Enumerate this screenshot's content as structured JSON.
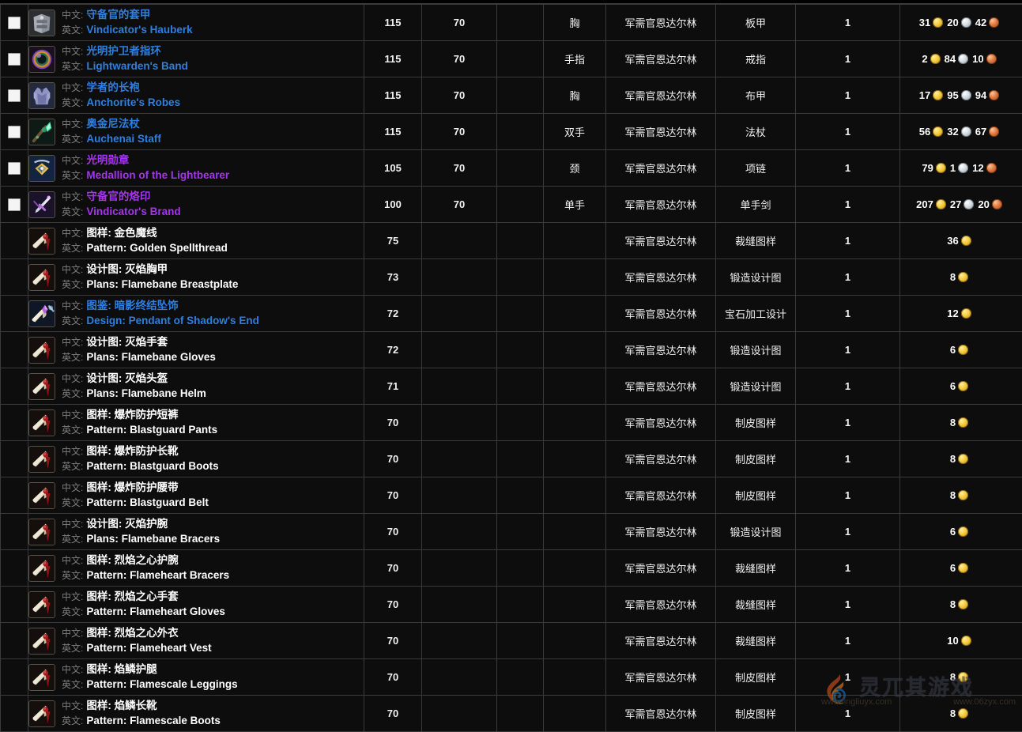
{
  "meta": {
    "label_cn": "中文:",
    "label_en": "英文:"
  },
  "watermark": {
    "text_cn": "灵兀其游戏",
    "url_left": "www.lingliuyx.com",
    "url_right": "www.06zyx.com"
  },
  "rows": [
    {
      "checkbox": true,
      "quality": "rare",
      "icon": "chest-mail-icon",
      "name_cn": "守备官的套甲",
      "name_en": "Vindicator's Hauberk",
      "ilvl": "115",
      "req": "70",
      "blank": "",
      "slot": "胸",
      "source": "军需官恩达尔林",
      "type": "板甲",
      "qty": "1",
      "price": [
        {
          "amount": "31",
          "coin": "g"
        },
        {
          "amount": "20",
          "coin": "s"
        },
        {
          "amount": "42",
          "coin": "c"
        }
      ]
    },
    {
      "checkbox": true,
      "quality": "rare",
      "icon": "ring-icon",
      "name_cn": "光明护卫者指环",
      "name_en": "Lightwarden's Band",
      "ilvl": "115",
      "req": "70",
      "blank": "",
      "slot": "手指",
      "source": "军需官恩达尔林",
      "type": "戒指",
      "qty": "1",
      "price": [
        {
          "amount": "2",
          "coin": "g"
        },
        {
          "amount": "84",
          "coin": "s"
        },
        {
          "amount": "10",
          "coin": "c"
        }
      ]
    },
    {
      "checkbox": true,
      "quality": "rare",
      "icon": "robe-icon",
      "name_cn": "学者的长袍",
      "name_en": "Anchorite's Robes",
      "ilvl": "115",
      "req": "70",
      "blank": "",
      "slot": "胸",
      "source": "军需官恩达尔林",
      "type": "布甲",
      "qty": "1",
      "price": [
        {
          "amount": "17",
          "coin": "g"
        },
        {
          "amount": "95",
          "coin": "s"
        },
        {
          "amount": "94",
          "coin": "c"
        }
      ]
    },
    {
      "checkbox": true,
      "quality": "rare",
      "icon": "staff-icon",
      "name_cn": "奥金尼法杖",
      "name_en": "Auchenai Staff",
      "ilvl": "115",
      "req": "70",
      "blank": "",
      "slot": "双手",
      "source": "军需官恩达尔林",
      "type": "法杖",
      "qty": "1",
      "price": [
        {
          "amount": "56",
          "coin": "g"
        },
        {
          "amount": "32",
          "coin": "s"
        },
        {
          "amount": "67",
          "coin": "c"
        }
      ]
    },
    {
      "checkbox": true,
      "quality": "epic",
      "icon": "medallion-icon",
      "name_cn": "光明勋章",
      "name_en": "Medallion of the Lightbearer",
      "ilvl": "105",
      "req": "70",
      "blank": "",
      "slot": "颈",
      "source": "军需官恩达尔林",
      "type": "项链",
      "qty": "1",
      "price": [
        {
          "amount": "79",
          "coin": "g"
        },
        {
          "amount": "1",
          "coin": "s"
        },
        {
          "amount": "12",
          "coin": "c"
        }
      ]
    },
    {
      "checkbox": true,
      "quality": "epic",
      "icon": "sword-icon",
      "name_cn": "守备官的烙印",
      "name_en": "Vindicator's Brand",
      "ilvl": "100",
      "req": "70",
      "blank": "",
      "slot": "单手",
      "source": "军需官恩达尔林",
      "type": "单手剑",
      "qty": "1",
      "price": [
        {
          "amount": "207",
          "coin": "g"
        },
        {
          "amount": "27",
          "coin": "s"
        },
        {
          "amount": "20",
          "coin": "c"
        }
      ]
    },
    {
      "checkbox": false,
      "quality": "common",
      "icon": "scroll-icon",
      "name_cn": "图样: 金色魔线",
      "name_en": "Pattern: Golden Spellthread",
      "ilvl": "75",
      "req": "",
      "blank": "",
      "slot": "",
      "source": "军需官恩达尔林",
      "type": "裁缝图样",
      "qty": "1",
      "price": [
        {
          "amount": "36",
          "coin": "g"
        }
      ]
    },
    {
      "checkbox": false,
      "quality": "common",
      "icon": "scroll-icon",
      "name_cn": "设计图: 灭焰胸甲",
      "name_en": "Plans: Flamebane Breastplate",
      "ilvl": "73",
      "req": "",
      "blank": "",
      "slot": "",
      "source": "军需官恩达尔林",
      "type": "锻造设计图",
      "qty": "1",
      "price": [
        {
          "amount": "8",
          "coin": "g"
        }
      ]
    },
    {
      "checkbox": false,
      "quality": "rare",
      "icon": "design-icon",
      "name_cn": "图鉴: 暗影终结坠饰",
      "name_en": "Design: Pendant of Shadow's End",
      "ilvl": "72",
      "req": "",
      "blank": "",
      "slot": "",
      "source": "军需官恩达尔林",
      "type": "宝石加工设计",
      "qty": "1",
      "price": [
        {
          "amount": "12",
          "coin": "g"
        }
      ]
    },
    {
      "checkbox": false,
      "quality": "common",
      "icon": "scroll-icon",
      "name_cn": "设计图: 灭焰手套",
      "name_en": "Plans: Flamebane Gloves",
      "ilvl": "72",
      "req": "",
      "blank": "",
      "slot": "",
      "source": "军需官恩达尔林",
      "type": "锻造设计图",
      "qty": "1",
      "price": [
        {
          "amount": "6",
          "coin": "g"
        }
      ]
    },
    {
      "checkbox": false,
      "quality": "common",
      "icon": "scroll-icon",
      "name_cn": "设计图: 灭焰头盔",
      "name_en": "Plans: Flamebane Helm",
      "ilvl": "71",
      "req": "",
      "blank": "",
      "slot": "",
      "source": "军需官恩达尔林",
      "type": "锻造设计图",
      "qty": "1",
      "price": [
        {
          "amount": "6",
          "coin": "g"
        }
      ]
    },
    {
      "checkbox": false,
      "quality": "common",
      "icon": "scroll-icon",
      "name_cn": "图样: 爆炸防护短裤",
      "name_en": "Pattern: Blastguard Pants",
      "ilvl": "70",
      "req": "",
      "blank": "",
      "slot": "",
      "source": "军需官恩达尔林",
      "type": "制皮图样",
      "qty": "1",
      "price": [
        {
          "amount": "8",
          "coin": "g"
        }
      ]
    },
    {
      "checkbox": false,
      "quality": "common",
      "icon": "scroll-icon",
      "name_cn": "图样: 爆炸防护长靴",
      "name_en": "Pattern: Blastguard Boots",
      "ilvl": "70",
      "req": "",
      "blank": "",
      "slot": "",
      "source": "军需官恩达尔林",
      "type": "制皮图样",
      "qty": "1",
      "price": [
        {
          "amount": "8",
          "coin": "g"
        }
      ]
    },
    {
      "checkbox": false,
      "quality": "common",
      "icon": "scroll-icon",
      "name_cn": "图样: 爆炸防护腰带",
      "name_en": "Pattern: Blastguard Belt",
      "ilvl": "70",
      "req": "",
      "blank": "",
      "slot": "",
      "source": "军需官恩达尔林",
      "type": "制皮图样",
      "qty": "1",
      "price": [
        {
          "amount": "8",
          "coin": "g"
        }
      ]
    },
    {
      "checkbox": false,
      "quality": "common",
      "icon": "scroll-icon",
      "name_cn": "设计图: 灭焰护腕",
      "name_en": "Plans: Flamebane Bracers",
      "ilvl": "70",
      "req": "",
      "blank": "",
      "slot": "",
      "source": "军需官恩达尔林",
      "type": "锻造设计图",
      "qty": "1",
      "price": [
        {
          "amount": "6",
          "coin": "g"
        }
      ]
    },
    {
      "checkbox": false,
      "quality": "common",
      "icon": "scroll-icon",
      "name_cn": "图样: 烈焰之心护腕",
      "name_en": "Pattern: Flameheart Bracers",
      "ilvl": "70",
      "req": "",
      "blank": "",
      "slot": "",
      "source": "军需官恩达尔林",
      "type": "裁缝图样",
      "qty": "1",
      "price": [
        {
          "amount": "6",
          "coin": "g"
        }
      ]
    },
    {
      "checkbox": false,
      "quality": "common",
      "icon": "scroll-icon",
      "name_cn": "图样: 烈焰之心手套",
      "name_en": "Pattern: Flameheart Gloves",
      "ilvl": "70",
      "req": "",
      "blank": "",
      "slot": "",
      "source": "军需官恩达尔林",
      "type": "裁缝图样",
      "qty": "1",
      "price": [
        {
          "amount": "8",
          "coin": "g"
        }
      ]
    },
    {
      "checkbox": false,
      "quality": "common",
      "icon": "scroll-icon",
      "name_cn": "图样: 烈焰之心外衣",
      "name_en": "Pattern: Flameheart Vest",
      "ilvl": "70",
      "req": "",
      "blank": "",
      "slot": "",
      "source": "军需官恩达尔林",
      "type": "裁缝图样",
      "qty": "1",
      "price": [
        {
          "amount": "10",
          "coin": "g"
        }
      ]
    },
    {
      "checkbox": false,
      "quality": "common",
      "icon": "scroll-icon",
      "name_cn": "图样: 焰鳞护腿",
      "name_en": "Pattern: Flamescale Leggings",
      "ilvl": "70",
      "req": "",
      "blank": "",
      "slot": "",
      "source": "军需官恩达尔林",
      "type": "制皮图样",
      "qty": "1",
      "price": [
        {
          "amount": "8",
          "coin": "g"
        }
      ]
    },
    {
      "checkbox": false,
      "quality": "common",
      "icon": "scroll-icon",
      "name_cn": "图样: 焰鳞长靴",
      "name_en": "Pattern: Flamescale Boots",
      "ilvl": "70",
      "req": "",
      "blank": "",
      "slot": "",
      "source": "军需官恩达尔林",
      "type": "制皮图样",
      "qty": "1",
      "price": [
        {
          "amount": "8",
          "coin": "g"
        }
      ]
    }
  ]
}
